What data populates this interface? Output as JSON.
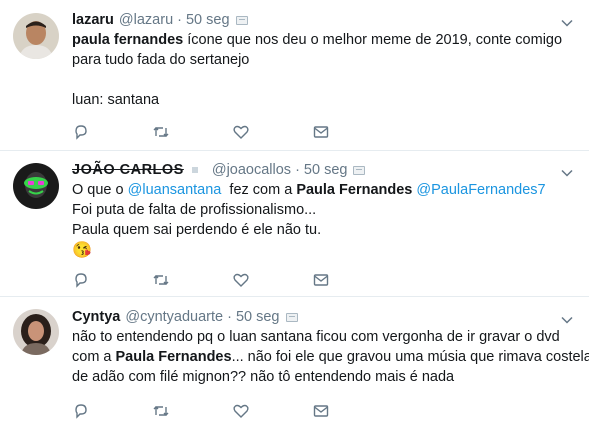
{
  "tweets": [
    {
      "name": "lazaru",
      "handle": "@lazaru",
      "time": "50 seg",
      "separator": "·",
      "lines": {
        "l1_bold": "paula fernandes",
        "l1_rest": " ícone que nos deu o melhor meme de 2019, conte comigo",
        "l2": "para tudo fada do sertanejo",
        "l4": "luan: santana"
      }
    },
    {
      "name": "JOÃO CARLOS",
      "handle": "@joaocallos",
      "time": "50 seg",
      "separator": "·",
      "lines": {
        "l1_a": "O que o ",
        "l1_mention": "@luansantana",
        "l1_b": "  fez com a ",
        "l1_bold": "Paula Fernandes",
        "l1_c": " ",
        "l1_mention2": "@PaulaFernandes7",
        "l2": "Foi puta de falta de profissionalismo...",
        "l3": "Paula quem sai perdendo é ele não tu.",
        "emoji": "😘"
      }
    },
    {
      "name": "Cyntya",
      "handle": "@cyntyaduarte",
      "time": "50 seg",
      "separator": "·",
      "lines": {
        "l1": "não to entendendo pq o luan santana ficou com vergonha de ir gravar o dvd",
        "l2_a": "com a ",
        "l2_bold": "Paula Fernandes",
        "l2_b": "... não foi ele que gravou uma músia que rimava costela",
        "l3": "de adão com filé mignon?? não tô entendendo mais é nada"
      }
    }
  ],
  "actions": [
    "reply-icon",
    "retweet-icon",
    "like-icon",
    "message-icon"
  ],
  "colors": {
    "link": "#1b95e0",
    "muted": "#657786",
    "icon": "#657786",
    "divider": "#e6ecf0"
  }
}
